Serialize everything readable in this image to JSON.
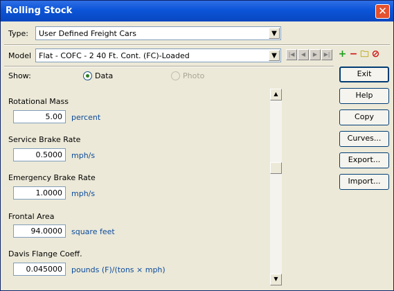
{
  "window": {
    "title": "Rolling Stock",
    "close_glyph": "✕"
  },
  "type_row": {
    "label": "Type:",
    "value": "User Defined Freight Cars"
  },
  "model_row": {
    "label": "Model",
    "value": "Flat - COFC - 2 40 Ft. Cont. (FC)-Loaded"
  },
  "show": {
    "label": "Show:",
    "data_label": "Data",
    "photo_label": "Photo"
  },
  "fields": [
    {
      "label": "Rotational Mass",
      "value": "5.00",
      "unit": "percent"
    },
    {
      "label": "Service Brake Rate",
      "value": "0.5000",
      "unit": "mph/s"
    },
    {
      "label": "Emergency Brake Rate",
      "value": "1.0000",
      "unit": "mph/s"
    },
    {
      "label": "Frontal Area",
      "value": "94.0000",
      "unit": "square feet"
    },
    {
      "label": "Davis Flange Coeff.",
      "value": "0.045000",
      "unit": "pounds (F)/(tons × mph)"
    }
  ],
  "buttons": {
    "exit": "Exit",
    "help": "Help",
    "copy": "Copy",
    "curves": "Curves...",
    "export": "Export...",
    "import": "Import..."
  },
  "nav": {
    "first": "|◀",
    "prev": "◀",
    "next": "▶",
    "last": "▶|"
  },
  "toolbar": {
    "add": "+",
    "remove": "−",
    "folder": "🗀",
    "no": "⊘"
  },
  "scroll": {
    "up": "▲",
    "down": "▼"
  },
  "combo_arrow": "▼"
}
